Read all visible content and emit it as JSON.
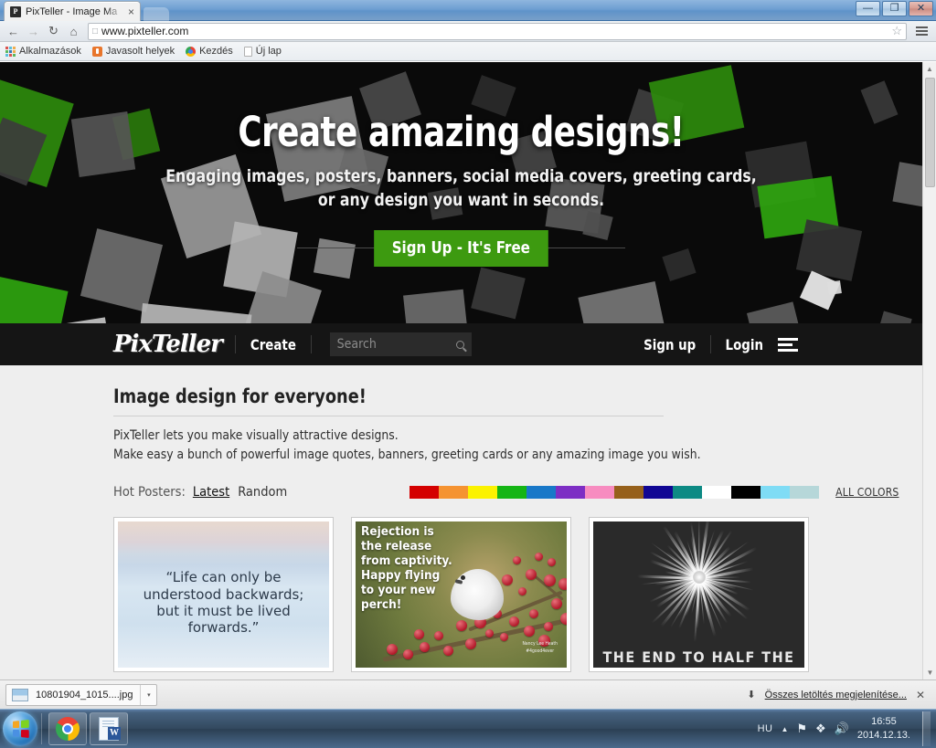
{
  "browser": {
    "tab": {
      "title": "PixTeller - Image Ma",
      "favicon_label": "P",
      "close_label": "×"
    },
    "window_controls": {
      "minimize": "—",
      "maximize": "❐",
      "close": "✕"
    },
    "nav": {
      "back": "←",
      "forward": "→",
      "reload": "↻",
      "home": "⌂"
    },
    "omnibox": {
      "url": "www.pixteller.com",
      "star": "☆",
      "page_icon": "□"
    },
    "bookmarks": [
      {
        "label": "Alkalmazások",
        "icon": "apps-grid-icon"
      },
      {
        "label": "Javasolt helyek",
        "icon": "suggested-sites-icon"
      },
      {
        "label": "Kezdés",
        "icon": "chrome-icon"
      },
      {
        "label": "Új lap",
        "icon": "page-icon"
      }
    ]
  },
  "hero": {
    "headline": "Create amazing designs!",
    "sub_line1": "Engaging images, posters, banners, social media covers, greeting cards,",
    "sub_line2": "or any design you want in seconds.",
    "cta_label": "Sign Up - It's Free",
    "cta_color": "#3d9a10",
    "background_color": "#0a0a0a"
  },
  "navbar": {
    "brand": "PixTeller",
    "create_label": "Create",
    "search_placeholder": "Search",
    "search_value": "",
    "signup_label": "Sign up",
    "login_label": "Login",
    "divider": "|"
  },
  "main": {
    "title": "Image design for everyone!",
    "paragraph_line1": "PixTeller lets you make visually attractive designs.",
    "paragraph_line2": "Make easy a bunch of powerful image quotes, banners, greeting cards or any amazing image you wish.",
    "hot_label": "Hot Posters:",
    "sort_options": [
      {
        "label": "Latest",
        "active": true
      },
      {
        "label": "Random",
        "active": false
      }
    ],
    "all_colors_label": "ALL COLORS",
    "swatches": [
      "#d40000",
      "#f59331",
      "#fbf200",
      "#14b514",
      "#1878c8",
      "#7d2ec4",
      "#f78cc0",
      "#96601b",
      "#100694",
      "#0d8a84",
      "#ffffff",
      "#000000",
      "#7fdcf5",
      "#b6d7d9"
    ]
  },
  "posters": [
    {
      "name": "life-quote-poster",
      "lines": [
        "“Life can only be",
        "understood backwards;",
        "but it must be lived",
        "forwards.”"
      ]
    },
    {
      "name": "rejection-bird-poster",
      "lines": [
        "Rejection is",
        "the release",
        "from captivity.",
        "Happy flying",
        "to your new",
        "perch!"
      ],
      "credit_line1": "Nancy Lee Heath",
      "credit_line2": "#4good4ever"
    },
    {
      "name": "fireworks-poster",
      "caption": "THE END TO HALF THE"
    }
  ],
  "downloads": {
    "file_name": "10801904_1015....jpg",
    "caret": "▾",
    "show_all_label": "Összes letöltés megjelenítése...",
    "down_arrow": "⬇",
    "close": "✕"
  },
  "taskbar": {
    "start_label": "Start",
    "items": [
      {
        "name": "chrome",
        "icon": "chrome-icon"
      },
      {
        "name": "word",
        "icon": "word-icon"
      }
    ],
    "tray": {
      "language": "HU",
      "caret": "▲",
      "network_icon": "⚑",
      "action_center_icon": "❖",
      "volume_icon": "🔊",
      "time": "16:55",
      "date": "2014.12.13."
    }
  },
  "scrollbar": {
    "up": "▲",
    "down": "▼"
  }
}
